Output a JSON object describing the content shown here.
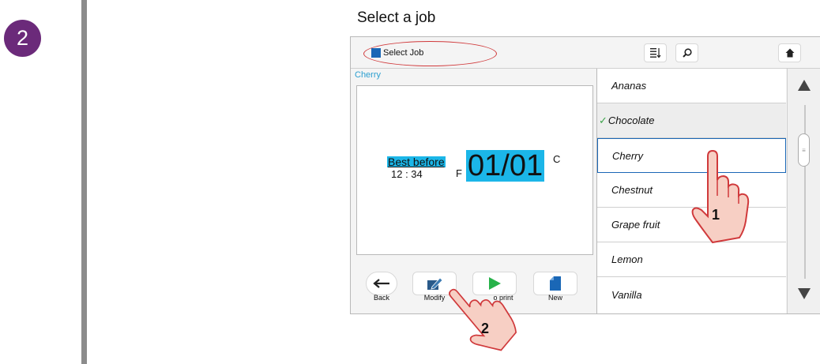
{
  "step": {
    "number": "2"
  },
  "instruction": {
    "title": "Select a job"
  },
  "topbar": {
    "job_label": "Select Job",
    "sort_icon": "sort-icon",
    "search_icon": "search-icon",
    "home_icon": "home-icon"
  },
  "job_name": "Cherry",
  "preview": {
    "best_before": "Best before",
    "time": "12 : 34",
    "f_letter": "F",
    "date": "01/01",
    "c_letter": "C"
  },
  "bottom_buttons": [
    {
      "label": "Back",
      "icon": "back-arrow-icon"
    },
    {
      "label": "Modify",
      "icon": "edit-icon"
    },
    {
      "label": "Go to print",
      "visible_label": "o print",
      "icon": "play-icon"
    },
    {
      "label": "New",
      "icon": "new-document-icon"
    }
  ],
  "job_list": [
    {
      "label": "Ananas"
    },
    {
      "label": "Chocolate",
      "checked": true
    },
    {
      "label": "Cherry",
      "selected": true
    },
    {
      "label": "Chestnut"
    },
    {
      "label": "Grape fruit"
    },
    {
      "label": "Lemon"
    },
    {
      "label": "Vanilla"
    }
  ],
  "callouts": {
    "hand1": "1",
    "hand2": "2"
  },
  "colors": {
    "accent": "#1bb6e8",
    "brand": "#1a67b6",
    "badge": "#6b2a7a",
    "highlight_ring": "#d0393b",
    "check": "#3ca34a"
  }
}
